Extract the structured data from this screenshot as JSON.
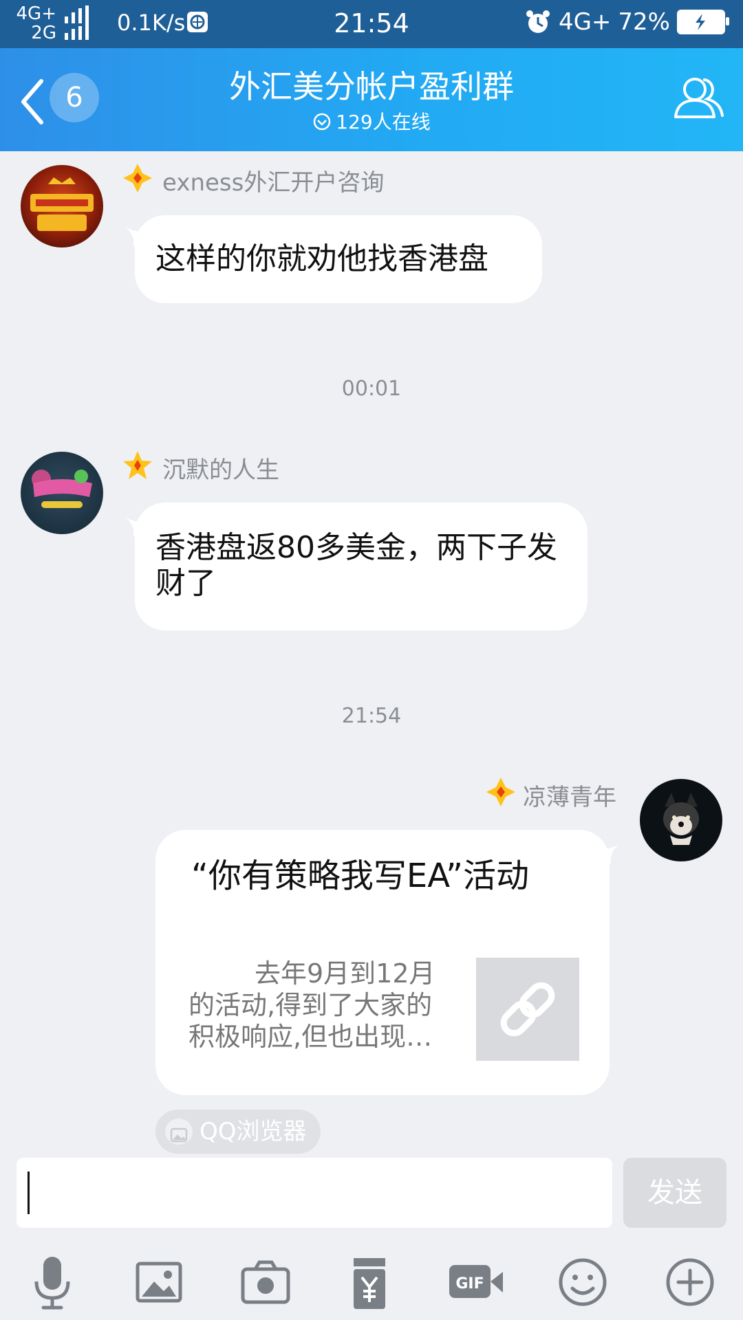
{
  "status_bar": {
    "network_top": "4G+",
    "network_bottom": "2G",
    "speed": "0.1K/s",
    "time": "21:54",
    "network_right": "4G+",
    "battery": "72%",
    "icons": [
      "signal-icon",
      "globe-icon",
      "alarm-icon",
      "battery-charging-icon"
    ]
  },
  "header": {
    "title": "外汇美分帐户盈利群",
    "unread_count": "6",
    "online": "129人在线",
    "icons": [
      "back-chevron-icon",
      "online-status-icon",
      "group-members-icon"
    ]
  },
  "messages": [
    {
      "sender": "exness外汇开户咨询",
      "text": "这样的你就劝他找香港盘"
    },
    {
      "timestamp": "00:01"
    },
    {
      "sender": "沉默的人生",
      "text": "香港盘返80多美金，两下子发财了"
    },
    {
      "timestamp": "21:54"
    },
    {
      "sender": "凉薄青年",
      "card": {
        "title": "“你有策略我写EA”活动",
        "description": "去年9月到12月的活动,得到了大家的积极响应,但也出现…",
        "source": "QQ浏览器"
      }
    }
  ],
  "input": {
    "value": "",
    "send_label": "发送"
  },
  "toolbar": [
    "microphone-icon",
    "image-icon",
    "camera-icon",
    "red-packet-icon",
    "gif-icon",
    "emoji-icon",
    "plus-icon"
  ],
  "colors": {
    "header": "#22a9f3",
    "status_bar": "#1f5f97",
    "background": "#eef0f4"
  }
}
